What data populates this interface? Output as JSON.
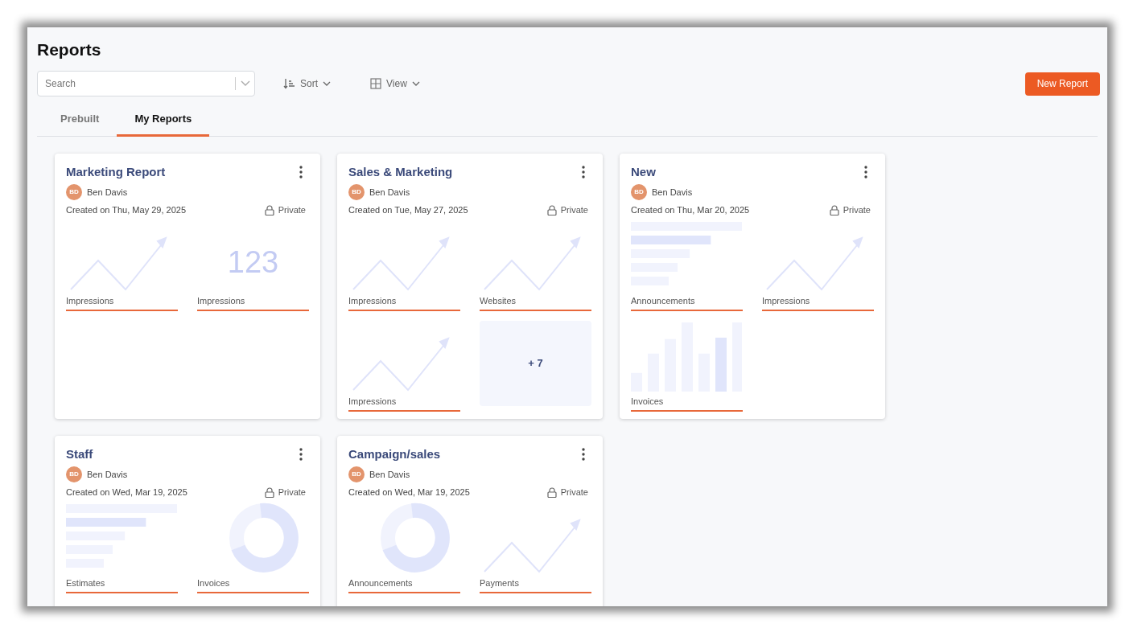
{
  "page": {
    "title": "Reports"
  },
  "toolbar": {
    "search": {
      "placeholder": "Search"
    },
    "sort": {
      "label": "Sort"
    },
    "view": {
      "label": "View"
    },
    "new_button": "New Report"
  },
  "tabs": [
    {
      "label": "Prebuilt",
      "selected": false
    },
    {
      "label": "My Reports",
      "selected": true
    }
  ],
  "cards": [
    {
      "title": "Marketing Report",
      "initials": "BD",
      "owner": "Ben Davis",
      "created": "Created on Thu, May 29, 2025",
      "visibility": "Private",
      "widgets": [
        {
          "kind": "line",
          "label": "Impressions"
        },
        {
          "kind": "number",
          "value": "123",
          "label": "Impressions"
        }
      ]
    },
    {
      "title": "Sales & Marketing",
      "initials": "BD",
      "owner": "Ben Davis",
      "created": "Created on Tue, May 27, 2025",
      "visibility": "Private",
      "widgets": [
        {
          "kind": "line",
          "label": "Impressions"
        },
        {
          "kind": "line",
          "label": "Websites"
        },
        {
          "kind": "line",
          "label": "Impressions"
        },
        {
          "kind": "more",
          "value": "+ 7"
        }
      ]
    },
    {
      "title": "New",
      "initials": "BD",
      "owner": "Ben Davis",
      "created": "Created on Thu, Mar 20, 2025",
      "visibility": "Private",
      "widgets": [
        {
          "kind": "hbar",
          "label": "Announcements"
        },
        {
          "kind": "line",
          "label": "Impressions"
        },
        {
          "kind": "vbar",
          "label": "Invoices"
        }
      ]
    },
    {
      "title": "Staff",
      "initials": "BD",
      "owner": "Ben Davis",
      "created": "Created on Wed, Mar 19, 2025",
      "visibility": "Private",
      "widgets": [
        {
          "kind": "hbar",
          "label": "Estimates"
        },
        {
          "kind": "donut",
          "label": "Invoices"
        }
      ]
    },
    {
      "title": "Campaign/sales",
      "initials": "BD",
      "owner": "Ben Davis",
      "created": "Created on Wed, Mar 19, 2025",
      "visibility": "Private",
      "widgets": [
        {
          "kind": "donut",
          "label": "Announcements"
        },
        {
          "kind": "line",
          "label": "Payments"
        }
      ]
    }
  ]
}
